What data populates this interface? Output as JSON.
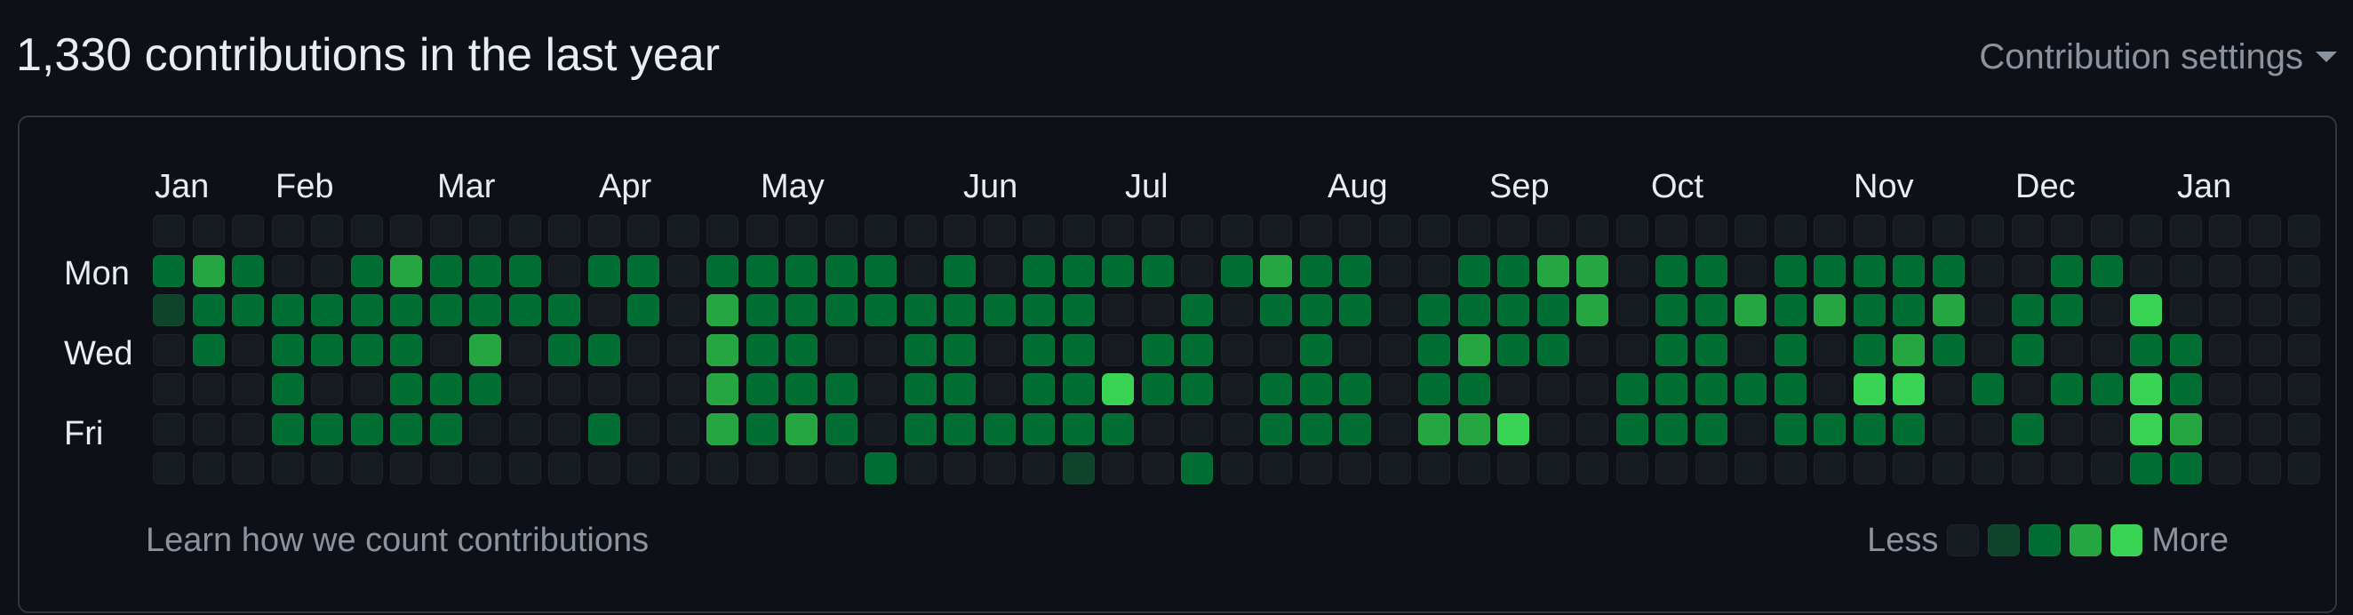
{
  "header": {
    "title": "1,330 contributions in the last year",
    "settings_label": "Contribution settings"
  },
  "calendar": {
    "months": [
      "Jan",
      "Feb",
      "Mar",
      "Apr",
      "May",
      "Jun",
      "Jul",
      "Aug",
      "Sep",
      "Oct",
      "Nov",
      "Dec",
      "Jan"
    ],
    "weekday_labels": [
      "Mon",
      "Wed",
      "Fri"
    ],
    "levels_by_row": [
      [
        0,
        0,
        0,
        0,
        0,
        0,
        0,
        0,
        0,
        0,
        0,
        0,
        0,
        0,
        0,
        0,
        0,
        0,
        0,
        0,
        0,
        0,
        0,
        0,
        0,
        0,
        0,
        0,
        0,
        0,
        0,
        0,
        0,
        0,
        0,
        0,
        0,
        0,
        0,
        0,
        0,
        0,
        0,
        0,
        0,
        0,
        0,
        0,
        0,
        0,
        0,
        0,
        0,
        0,
        0
      ],
      [
        2,
        3,
        2,
        0,
        0,
        2,
        3,
        2,
        2,
        2,
        0,
        2,
        2,
        0,
        2,
        2,
        2,
        2,
        2,
        0,
        2,
        0,
        2,
        2,
        2,
        2,
        0,
        2,
        3,
        2,
        2,
        0,
        0,
        2,
        2,
        3,
        3,
        0,
        2,
        2,
        0,
        2,
        2,
        2,
        2,
        2,
        0,
        0,
        2,
        2,
        0,
        0,
        0,
        0,
        0
      ],
      [
        1,
        2,
        2,
        2,
        2,
        2,
        2,
        2,
        2,
        2,
        2,
        0,
        2,
        0,
        3,
        2,
        2,
        2,
        2,
        2,
        2,
        2,
        2,
        2,
        0,
        0,
        2,
        0,
        2,
        2,
        2,
        0,
        2,
        2,
        2,
        2,
        3,
        0,
        2,
        2,
        3,
        2,
        3,
        2,
        2,
        3,
        0,
        2,
        2,
        0,
        4,
        0,
        0,
        0,
        0
      ],
      [
        0,
        2,
        0,
        2,
        2,
        2,
        2,
        0,
        3,
        0,
        2,
        2,
        0,
        0,
        3,
        2,
        2,
        0,
        0,
        2,
        2,
        0,
        2,
        2,
        0,
        2,
        2,
        0,
        0,
        2,
        0,
        0,
        2,
        3,
        2,
        2,
        0,
        0,
        2,
        2,
        0,
        2,
        0,
        2,
        3,
        2,
        0,
        2,
        0,
        0,
        2,
        2,
        0,
        0,
        0
      ],
      [
        0,
        0,
        0,
        2,
        0,
        0,
        2,
        2,
        2,
        0,
        0,
        0,
        0,
        0,
        3,
        2,
        2,
        2,
        0,
        2,
        2,
        0,
        2,
        2,
        4,
        2,
        2,
        0,
        2,
        2,
        2,
        0,
        2,
        2,
        0,
        0,
        0,
        2,
        2,
        2,
        2,
        2,
        0,
        4,
        4,
        0,
        2,
        0,
        2,
        2,
        4,
        2,
        0,
        0,
        0
      ],
      [
        0,
        0,
        0,
        2,
        2,
        2,
        2,
        2,
        0,
        0,
        0,
        2,
        0,
        0,
        3,
        2,
        3,
        2,
        0,
        2,
        2,
        2,
        2,
        2,
        2,
        0,
        0,
        0,
        2,
        2,
        2,
        0,
        3,
        3,
        4,
        0,
        0,
        2,
        2,
        2,
        0,
        2,
        2,
        2,
        2,
        0,
        0,
        2,
        0,
        0,
        4,
        3,
        0,
        0,
        0
      ],
      [
        0,
        0,
        0,
        0,
        0,
        0,
        0,
        0,
        0,
        0,
        0,
        0,
        0,
        0,
        0,
        0,
        0,
        0,
        2,
        0,
        0,
        0,
        0,
        1,
        0,
        0,
        2,
        0,
        0,
        0,
        0,
        0,
        0,
        0,
        0,
        0,
        0,
        0,
        0,
        0,
        0,
        0,
        0,
        0,
        0,
        0,
        0,
        0,
        0,
        0,
        2,
        2,
        0,
        0,
        0
      ]
    ]
  },
  "footer": {
    "learn_label": "Learn how we count contributions",
    "less_label": "Less",
    "more_label": "More"
  },
  "colors": {
    "background": "#0d1117",
    "cell_empty": "#161b22",
    "level_1": "#0e4429",
    "level_2": "#006d32",
    "level_3": "#26a641",
    "level_4": "#39d353",
    "border": "#30363d",
    "text_primary": "#e6edf3",
    "text_secondary": "#8b949e"
  }
}
